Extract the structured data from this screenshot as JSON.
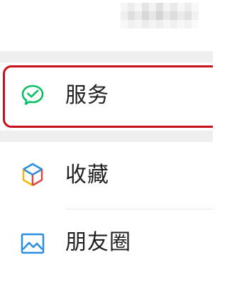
{
  "menu": {
    "items": [
      {
        "label": "服务",
        "icon": "wechat-pay-icon",
        "highlighted": true
      },
      {
        "label": "收藏",
        "icon": "favorites-cube-icon",
        "highlighted": false
      },
      {
        "label": "朋友圈",
        "icon": "moments-image-icon",
        "highlighted": false
      }
    ]
  },
  "colors": {
    "highlight_border": "#c8101d",
    "section_gap": "#efefef",
    "text": "#1f1f1f",
    "pay_green": "#07c160",
    "moments_blue": "#2a8de0"
  }
}
